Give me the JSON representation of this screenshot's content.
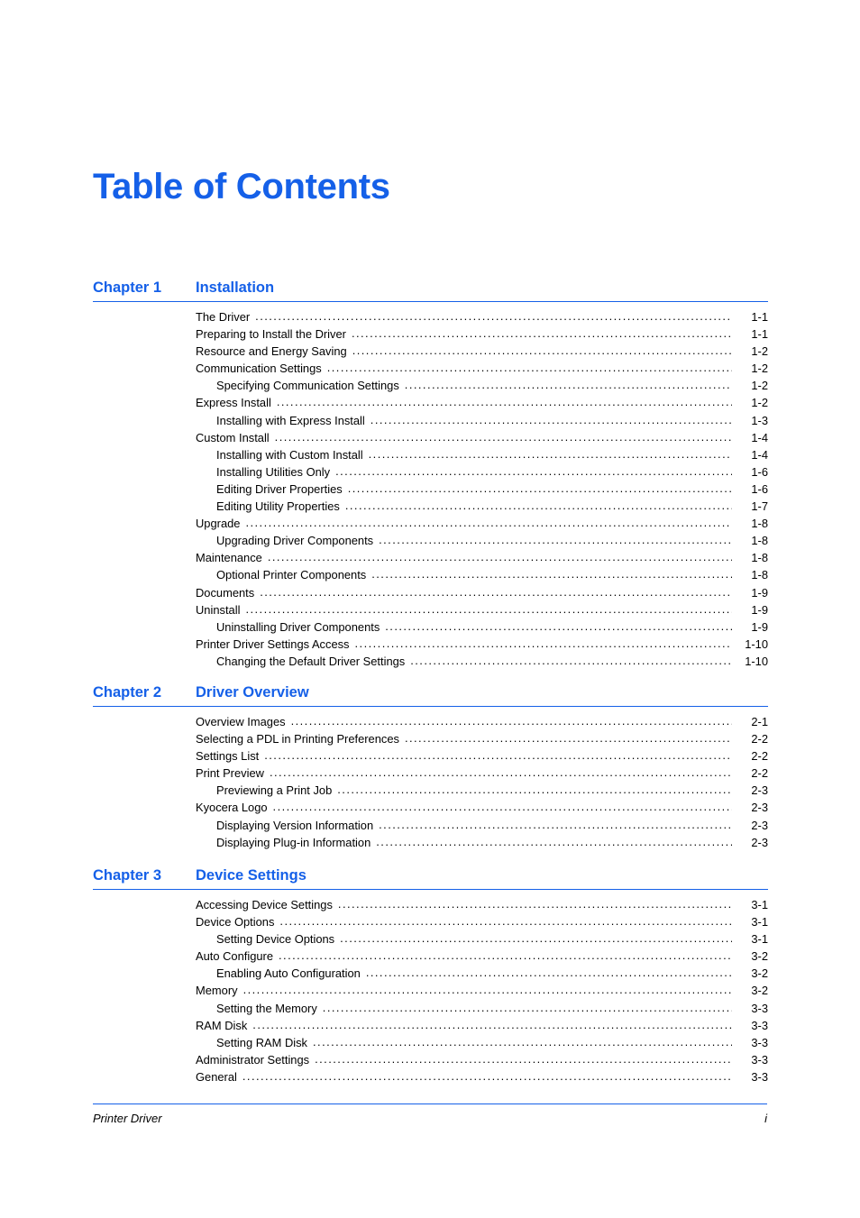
{
  "document": {
    "title": "Table of Contents",
    "accent_color": "#1560e8",
    "text_color": "#000000",
    "background_color": "#ffffff"
  },
  "footer": {
    "left": "Printer Driver",
    "right": "i"
  },
  "chapters": [
    {
      "number": "Chapter 1",
      "title": "Installation",
      "entries": [
        {
          "level": 1,
          "label": "The Driver",
          "page": "1-1"
        },
        {
          "level": 1,
          "label": "Preparing to Install the Driver",
          "page": "1-1"
        },
        {
          "level": 1,
          "label": "Resource and Energy Saving",
          "page": "1-2"
        },
        {
          "level": 1,
          "label": "Communication Settings",
          "page": "1-2"
        },
        {
          "level": 2,
          "label": "Specifying Communication Settings",
          "page": "1-2"
        },
        {
          "level": 1,
          "label": "Express Install",
          "page": "1-2"
        },
        {
          "level": 2,
          "label": "Installing with Express Install",
          "page": "1-3"
        },
        {
          "level": 1,
          "label": "Custom Install",
          "page": "1-4"
        },
        {
          "level": 2,
          "label": "Installing with Custom Install",
          "page": "1-4"
        },
        {
          "level": 2,
          "label": "Installing Utilities Only",
          "page": "1-6"
        },
        {
          "level": 2,
          "label": "Editing Driver Properties",
          "page": "1-6"
        },
        {
          "level": 2,
          "label": "Editing Utility Properties",
          "page": "1-7"
        },
        {
          "level": 1,
          "label": "Upgrade",
          "page": "1-8"
        },
        {
          "level": 2,
          "label": "Upgrading Driver Components",
          "page": "1-8"
        },
        {
          "level": 1,
          "label": "Maintenance",
          "page": "1-8"
        },
        {
          "level": 2,
          "label": "Optional Printer Components",
          "page": "1-8"
        },
        {
          "level": 1,
          "label": "Documents",
          "page": "1-9"
        },
        {
          "level": 1,
          "label": "Uninstall",
          "page": "1-9"
        },
        {
          "level": 2,
          "label": "Uninstalling Driver Components",
          "page": "1-9"
        },
        {
          "level": 1,
          "label": "Printer Driver Settings Access",
          "page": "1-10"
        },
        {
          "level": 2,
          "label": "Changing the Default Driver Settings",
          "page": "1-10"
        }
      ]
    },
    {
      "number": "Chapter 2",
      "title": "Driver Overview",
      "entries": [
        {
          "level": 1,
          "label": "Overview Images",
          "page": "2-1"
        },
        {
          "level": 1,
          "label": "Selecting a PDL in Printing Preferences",
          "page": "2-2"
        },
        {
          "level": 1,
          "label": "Settings List",
          "page": "2-2"
        },
        {
          "level": 1,
          "label": "Print Preview",
          "page": "2-2"
        },
        {
          "level": 2,
          "label": "Previewing a Print Job",
          "page": "2-3"
        },
        {
          "level": 1,
          "label": "Kyocera Logo",
          "page": "2-3"
        },
        {
          "level": 2,
          "label": "Displaying Version Information",
          "page": "2-3"
        },
        {
          "level": 2,
          "label": "Displaying Plug-in Information",
          "page": "2-3"
        }
      ]
    },
    {
      "number": "Chapter 3",
      "title": "Device Settings",
      "entries": [
        {
          "level": 1,
          "label": "Accessing Device Settings",
          "page": "3-1"
        },
        {
          "level": 1,
          "label": "Device Options",
          "page": "3-1"
        },
        {
          "level": 2,
          "label": "Setting Device Options",
          "page": "3-1"
        },
        {
          "level": 1,
          "label": "Auto Configure",
          "page": "3-2"
        },
        {
          "level": 2,
          "label": "Enabling Auto Configuration",
          "page": "3-2"
        },
        {
          "level": 1,
          "label": "Memory",
          "page": "3-2"
        },
        {
          "level": 2,
          "label": "Setting the Memory",
          "page": "3-3"
        },
        {
          "level": 1,
          "label": "RAM Disk",
          "page": "3-3"
        },
        {
          "level": 2,
          "label": "Setting RAM Disk",
          "page": "3-3"
        },
        {
          "level": 1,
          "label": "Administrator Settings",
          "page": "3-3"
        },
        {
          "level": 1,
          "label": "General",
          "page": "3-3"
        }
      ]
    }
  ],
  "chapter_tops": [
    310,
    759,
    962
  ]
}
